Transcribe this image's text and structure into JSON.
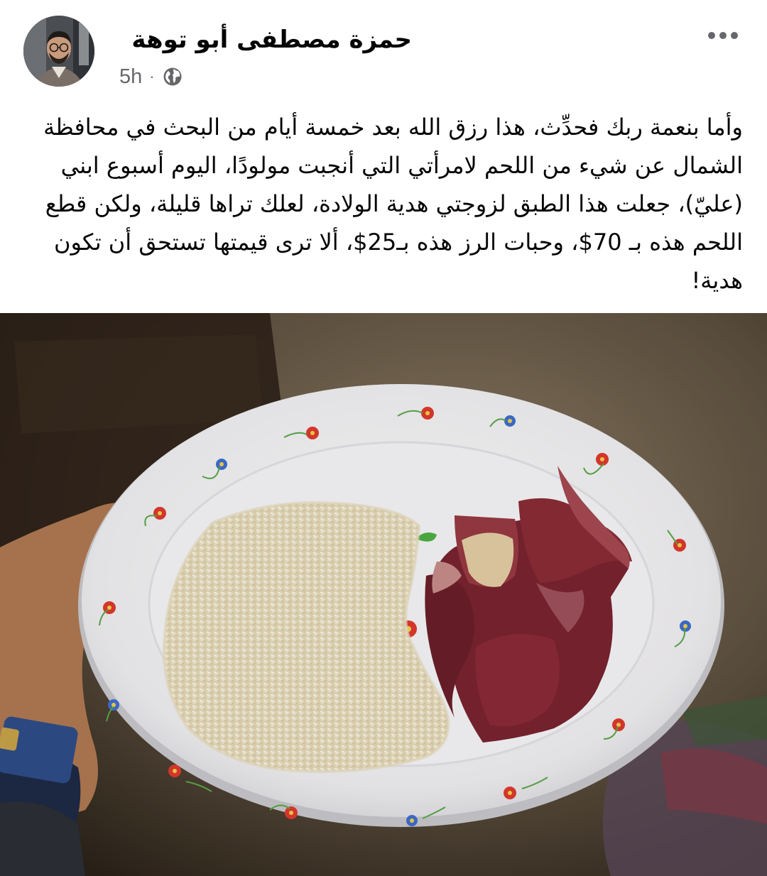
{
  "post": {
    "author": "حمزة مصطفى أبو توهة",
    "time": "5h",
    "separator": "·",
    "audience_icon": "globe-icon",
    "more_icon": "more-horizontal-icon",
    "text": "وأما بنعمة ربك فحدِّث، هذا رزق الله بعد خمسة أيام من البحث في محافظة الشمال عن شيء من اللحم لامرأتي التي أنجبت مولودًا، اليوم أسبوع ابني (عليّ)، جعلت هذا الطبق لزوجتي هدية الولادة، لعلك تراها قليلة، ولكن قطع اللحم هذه بـ 70$، وحبات الرز هذه بـ25$، ألا ترى قيمتها تستحق أن تكون هدية!"
  },
  "colors": {
    "text_primary": "#050505",
    "text_secondary": "#65676b",
    "background": "#ffffff"
  }
}
